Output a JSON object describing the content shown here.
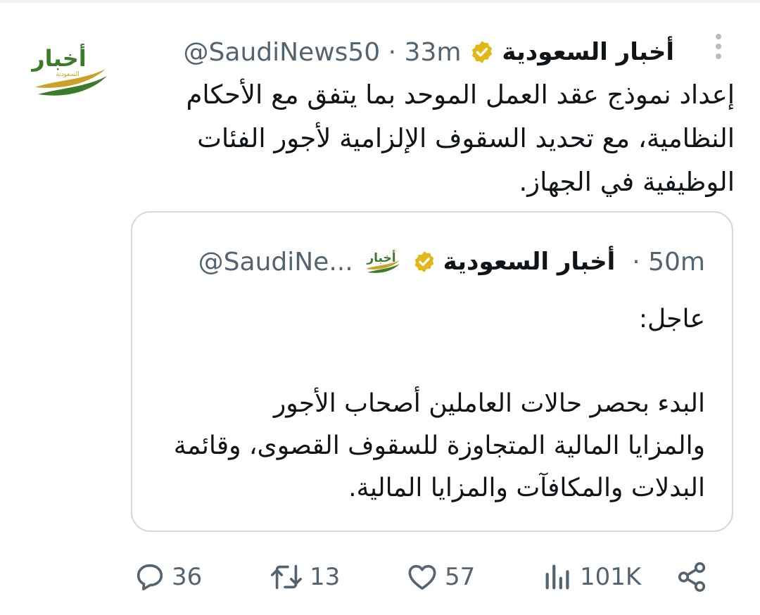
{
  "tweet": {
    "display_name": "أخبار السعودية",
    "handle_time": "@SaudiNews50 · 33m",
    "text_lines": [
      "إعداد نموذج عقد العمل الموحد بما يتفق مع الأحكام",
      "النظامية، مع تحديد السقوف الإلزامية لأجور الفئات",
      "الوظيفية في الجهاز."
    ],
    "avatar": {
      "icon": "saudi-news-logo",
      "text": "أخبار",
      "subtext": "السعودية"
    }
  },
  "quote": {
    "display_name": "أخبار السعودية",
    "handle": "@SaudiNe...",
    "time": "· 50m",
    "avatar_text": "أخبار",
    "heading": "عاجل:",
    "body_lines": [
      "البدء بحصر حالات العاملين أصحاب الأجور",
      "والمزايا المالية المتجاوزة للسقوف القصوى، وقائمة",
      "البدلات والمكافآت والمزايا المالية."
    ]
  },
  "actions": {
    "replies": "36",
    "retweets": "13",
    "likes": "57",
    "views": "101K"
  },
  "colors": {
    "verified_gold": "#e2b719",
    "logo_green": "#3d7a2a",
    "logo_gold": "#c9a227",
    "secondary_text": "#536471",
    "border": "#cfd9de"
  }
}
